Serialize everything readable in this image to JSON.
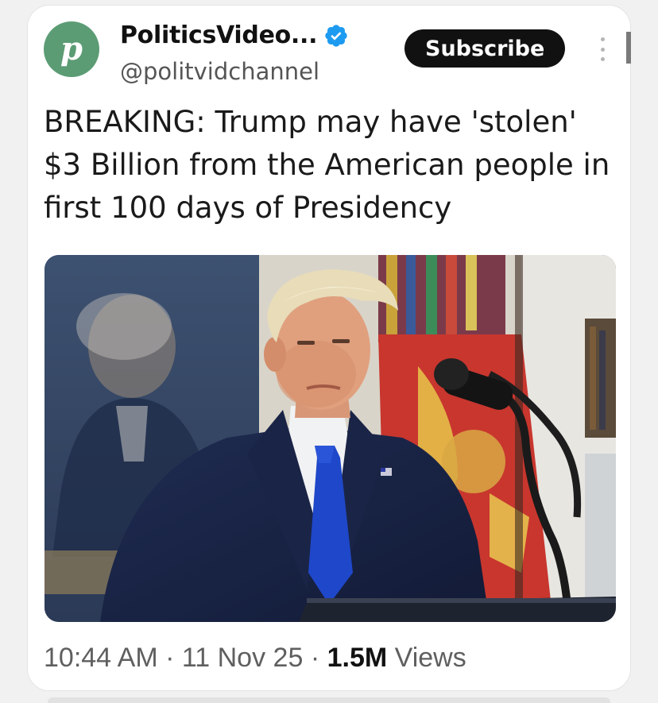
{
  "post": {
    "avatar_letter": "p",
    "display_name": "PoliticsVideo...",
    "verified_icon": "verified-badge-icon",
    "handle": "@politvidchannel",
    "subscribe_label": "Subscribe",
    "more_icon": "more-options-icon",
    "text": "BREAKING: Trump may have 'stolen' $3 Billion from the American people in first 100 days of Presidency",
    "media_alt": "photo",
    "time": "10:44 AM",
    "separator": "·",
    "date": "11 Nov 25",
    "views_count": "1.5M",
    "views_label": "Views"
  },
  "colors": {
    "avatar_bg": "#5b9c74",
    "verified_blue": "#1d9bf0",
    "subscribe_bg": "#111111",
    "text": "#1a1a1a",
    "meta": "#5f5f5f"
  }
}
